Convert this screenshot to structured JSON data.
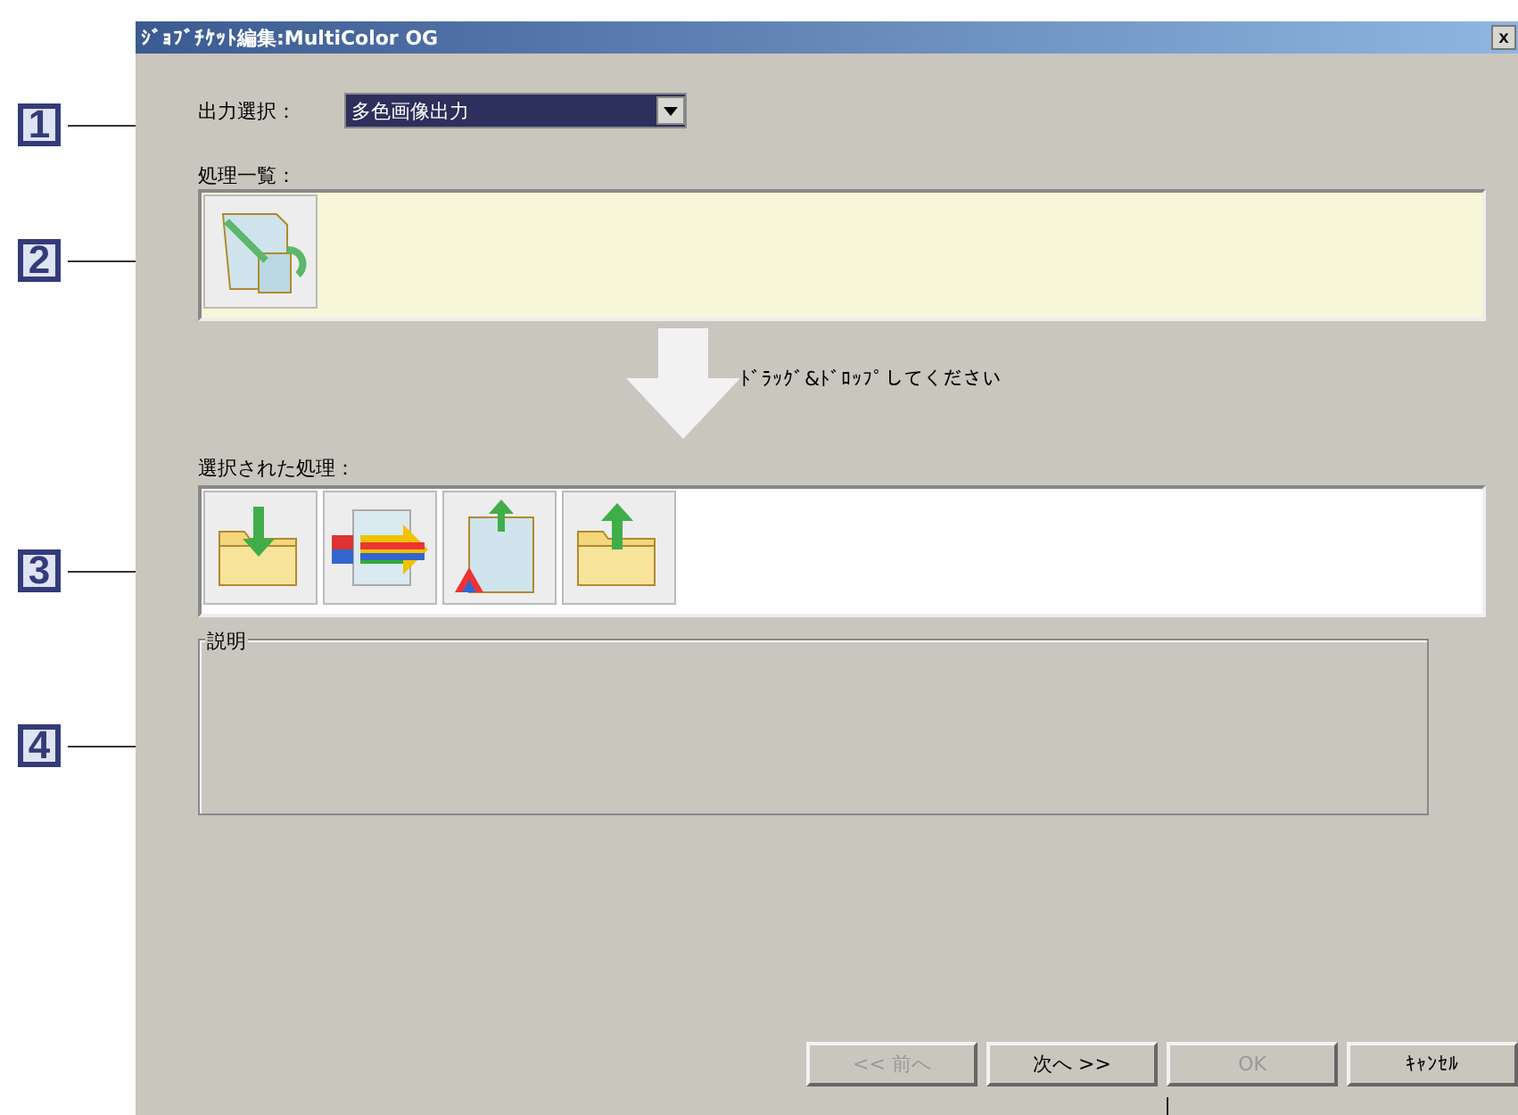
{
  "callouts": [
    {
      "label": "1"
    },
    {
      "label": "2"
    },
    {
      "label": "3"
    },
    {
      "label": "4"
    }
  ],
  "window": {
    "title": "ｼﾞｮﾌﾞﾁｹｯﾄ編集:MultiColor OG",
    "close": "x"
  },
  "output_select": {
    "label": "出力選択：",
    "value": "多色画像出力"
  },
  "process_list": {
    "label": "処理一覧：",
    "items": [
      {
        "kind": "resize"
      }
    ]
  },
  "drag_hint": "ﾄﾞﾗｯｸﾞ&ﾄﾞﾛｯﾌﾟしてください",
  "selected_processes": {
    "label": "選択された処理：",
    "items": [
      {
        "kind": "import"
      },
      {
        "kind": "convert"
      },
      {
        "kind": "output"
      },
      {
        "kind": "export"
      }
    ]
  },
  "description": {
    "label": "説明"
  },
  "buttons": [
    {
      "label": "<< 前へ",
      "disabled": true
    },
    {
      "label": "次へ >>",
      "disabled": false
    },
    {
      "label": "OK",
      "disabled": true
    },
    {
      "label": "ｷｬﾝｾﾙ",
      "disabled": false
    }
  ]
}
